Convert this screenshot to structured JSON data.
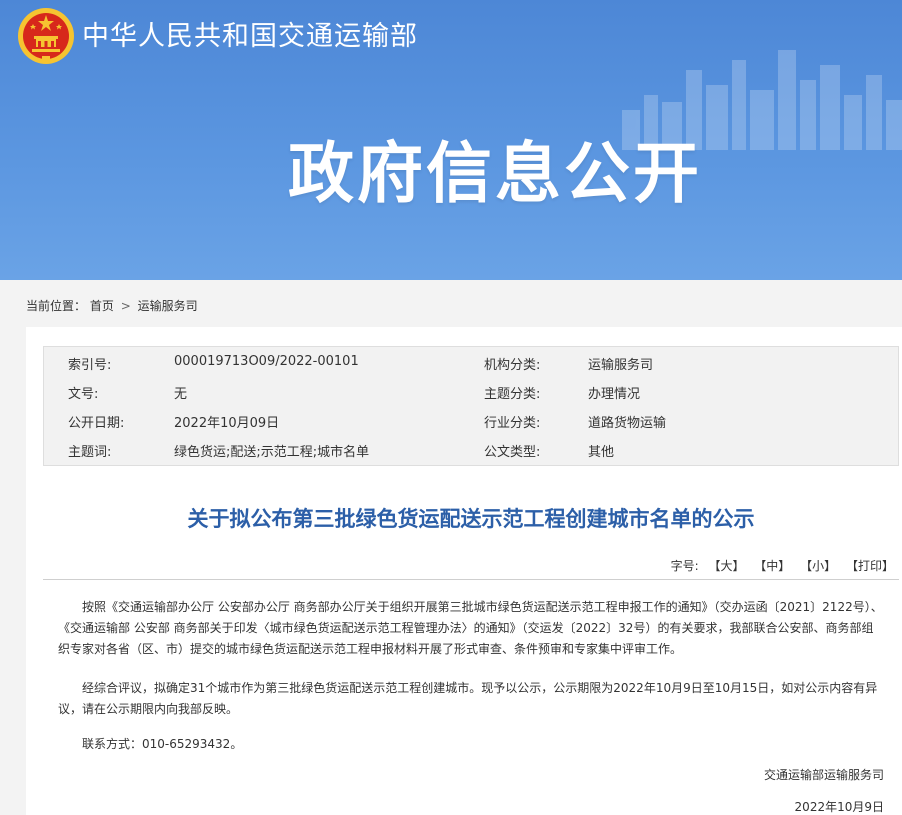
{
  "header": {
    "site_name": "中华人民共和国交通运输部",
    "section_title": "政府信息公开"
  },
  "breadcrumb": {
    "label": "当前位置：",
    "home": "首页",
    "separator": ">",
    "current": "运输服务司"
  },
  "meta": {
    "rows": [
      {
        "k1": "索引号:",
        "v1": "000019713O09/2022-00101",
        "k2": "机构分类:",
        "v2": "运输服务司"
      },
      {
        "k1": "文号:",
        "v1": "无",
        "k2": "主题分类:",
        "v2": "办理情况"
      },
      {
        "k1": "公开日期:",
        "v1": "2022年10月09日",
        "k2": "行业分类:",
        "v2": "道路货物运输"
      },
      {
        "k1": "主题词:",
        "v1": "绿色货运;配送;示范工程;城市名单",
        "k2": "公文类型:",
        "v2": "其他"
      }
    ]
  },
  "article": {
    "title": "关于拟公布第三批绿色货运配送示范工程创建城市名单的公示",
    "font_size": {
      "label": "字号:",
      "large": "【大】",
      "medium": "【中】",
      "small": "【小】",
      "print": "【打印】"
    },
    "paragraphs": [
      "按照《交通运输部办公厅 公安部办公厅 商务部办公厅关于组织开展第三批城市绿色货运配送示范工程申报工作的通知》（交办运函〔2021〕2122号）、《交通运输部 公安部 商务部关于印发〈城市绿色货运配送示范工程管理办法〉的通知》（交运发〔2022〕32号）的有关要求，我部联合公安部、商务部组织专家对各省（区、市）提交的城市绿色货运配送示范工程申报材料开展了形式审查、条件预审和专家集中评审工作。",
      "经综合评议，拟确定31个城市作为第三批绿色货运配送示范工程创建城市。现予以公示，公示期限为2022年10月9日至10月15日，如对公示内容有异议，请在公示期限内向我部反映。",
      "联系方式：010-65293432。"
    ],
    "signature_org": "交通运输部运输服务司",
    "signature_date": "2022年10月9日"
  },
  "colors": {
    "banner": "#5b96e0",
    "title_blue": "#2c5fa8",
    "emblem_red": "#d7281b",
    "emblem_gold": "#f6c431"
  }
}
